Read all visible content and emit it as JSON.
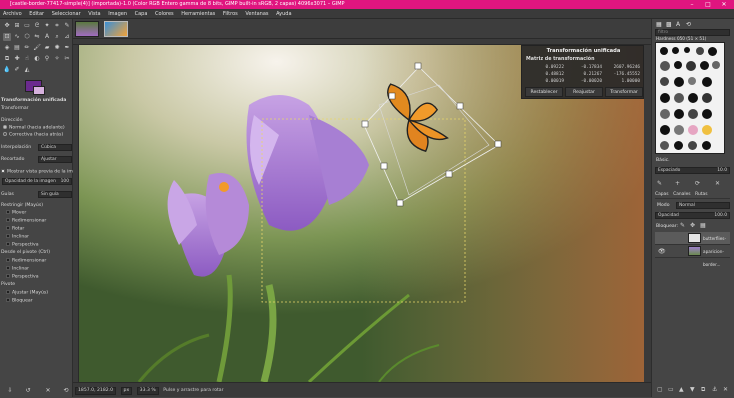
{
  "titlebar": {
    "title": "[castle-border-77417-simple(4)] (importada)-1.0 (Color RGB Entero gamma de 8 bits, GIMP built-in sRGB, 2 capas) 4096x3071 – GIMP",
    "minimize": "–",
    "maximize": "□",
    "close": "✕"
  },
  "menubar": {
    "items": [
      "Archivo",
      "Editar",
      "Seleccionar",
      "Vista",
      "Imagen",
      "Capa",
      "Colores",
      "Herramientas",
      "Filtros",
      "Ventanas",
      "Ayuda"
    ]
  },
  "tool_options": {
    "title": "Transformación unificada",
    "transform_label": "Transformar",
    "direction_label": "Dirección",
    "direction_normal": "Normal (hacia adelante)",
    "direction_corrective": "Correctiva (hacia atrás)",
    "interpolation_label": "Interpolación",
    "interpolation_value": "Cúbica",
    "clipping_label": "Recortado",
    "clipping_value": "Ajustar",
    "preview_label": "Mostrar vista previa de la im",
    "opacity_label": "Opacidad de la imagen",
    "opacity_value": "100",
    "guides_label": "Guías",
    "guides_value": "Sin guía",
    "constrain_label": "Restringir (Mayús)",
    "constrain_items": [
      "Mover",
      "Redimensionar",
      "Rotar",
      "Inclinar",
      "Perspectiva"
    ],
    "pivot_label": "Desde el pivote (Ctrl)",
    "pivot_items": [
      "Redimensionar",
      "Inclinar",
      "Perspectiva"
    ],
    "pivot2_label": "Pivote",
    "pivot2_items": [
      "Ajustar (Mayús)",
      "Bloquear"
    ]
  },
  "transform_dialog": {
    "title": "Transformación unificada",
    "matrix_label": "Matriz de transformación",
    "matrix": [
      [
        "0.09222",
        "-0.17834",
        "2607.96246"
      ],
      [
        "0.48812",
        "0.21267",
        "-176.45552"
      ],
      [
        "0.00019",
        "-0.00020",
        "1.00000"
      ]
    ],
    "reset_button": "Restablecer",
    "readjust_button": "Reajustar",
    "transform_button": "Transformar"
  },
  "statusbar": {
    "coords": "1857.0, 2182.0",
    "unit": "px",
    "zoom": "33.3 %",
    "message": "Pulse y arrastre para rotar"
  },
  "right_dock": {
    "filter_placeholder": "filtro",
    "brush_name": "Hardness 050 (51 × 51)",
    "brush_category": "Básic.",
    "spacing_label": "Espaciado",
    "spacing_value": "10.0",
    "tabs": [
      "Capas",
      "Canales",
      "Rutas"
    ],
    "mode_label": "Modo",
    "mode_value": "Normal",
    "opacity_label": "Opacidad",
    "opacity_value": "100.0",
    "lock_label": "Bloquear:",
    "layers": [
      {
        "name": "butterflies-gnu...",
        "selected": true
      },
      {
        "name": "aparicion-border...",
        "selected": false
      }
    ]
  },
  "colors": {
    "foreground": "#6b2a8e",
    "background": "#d7b2de",
    "titlebar": "#e0157f"
  }
}
